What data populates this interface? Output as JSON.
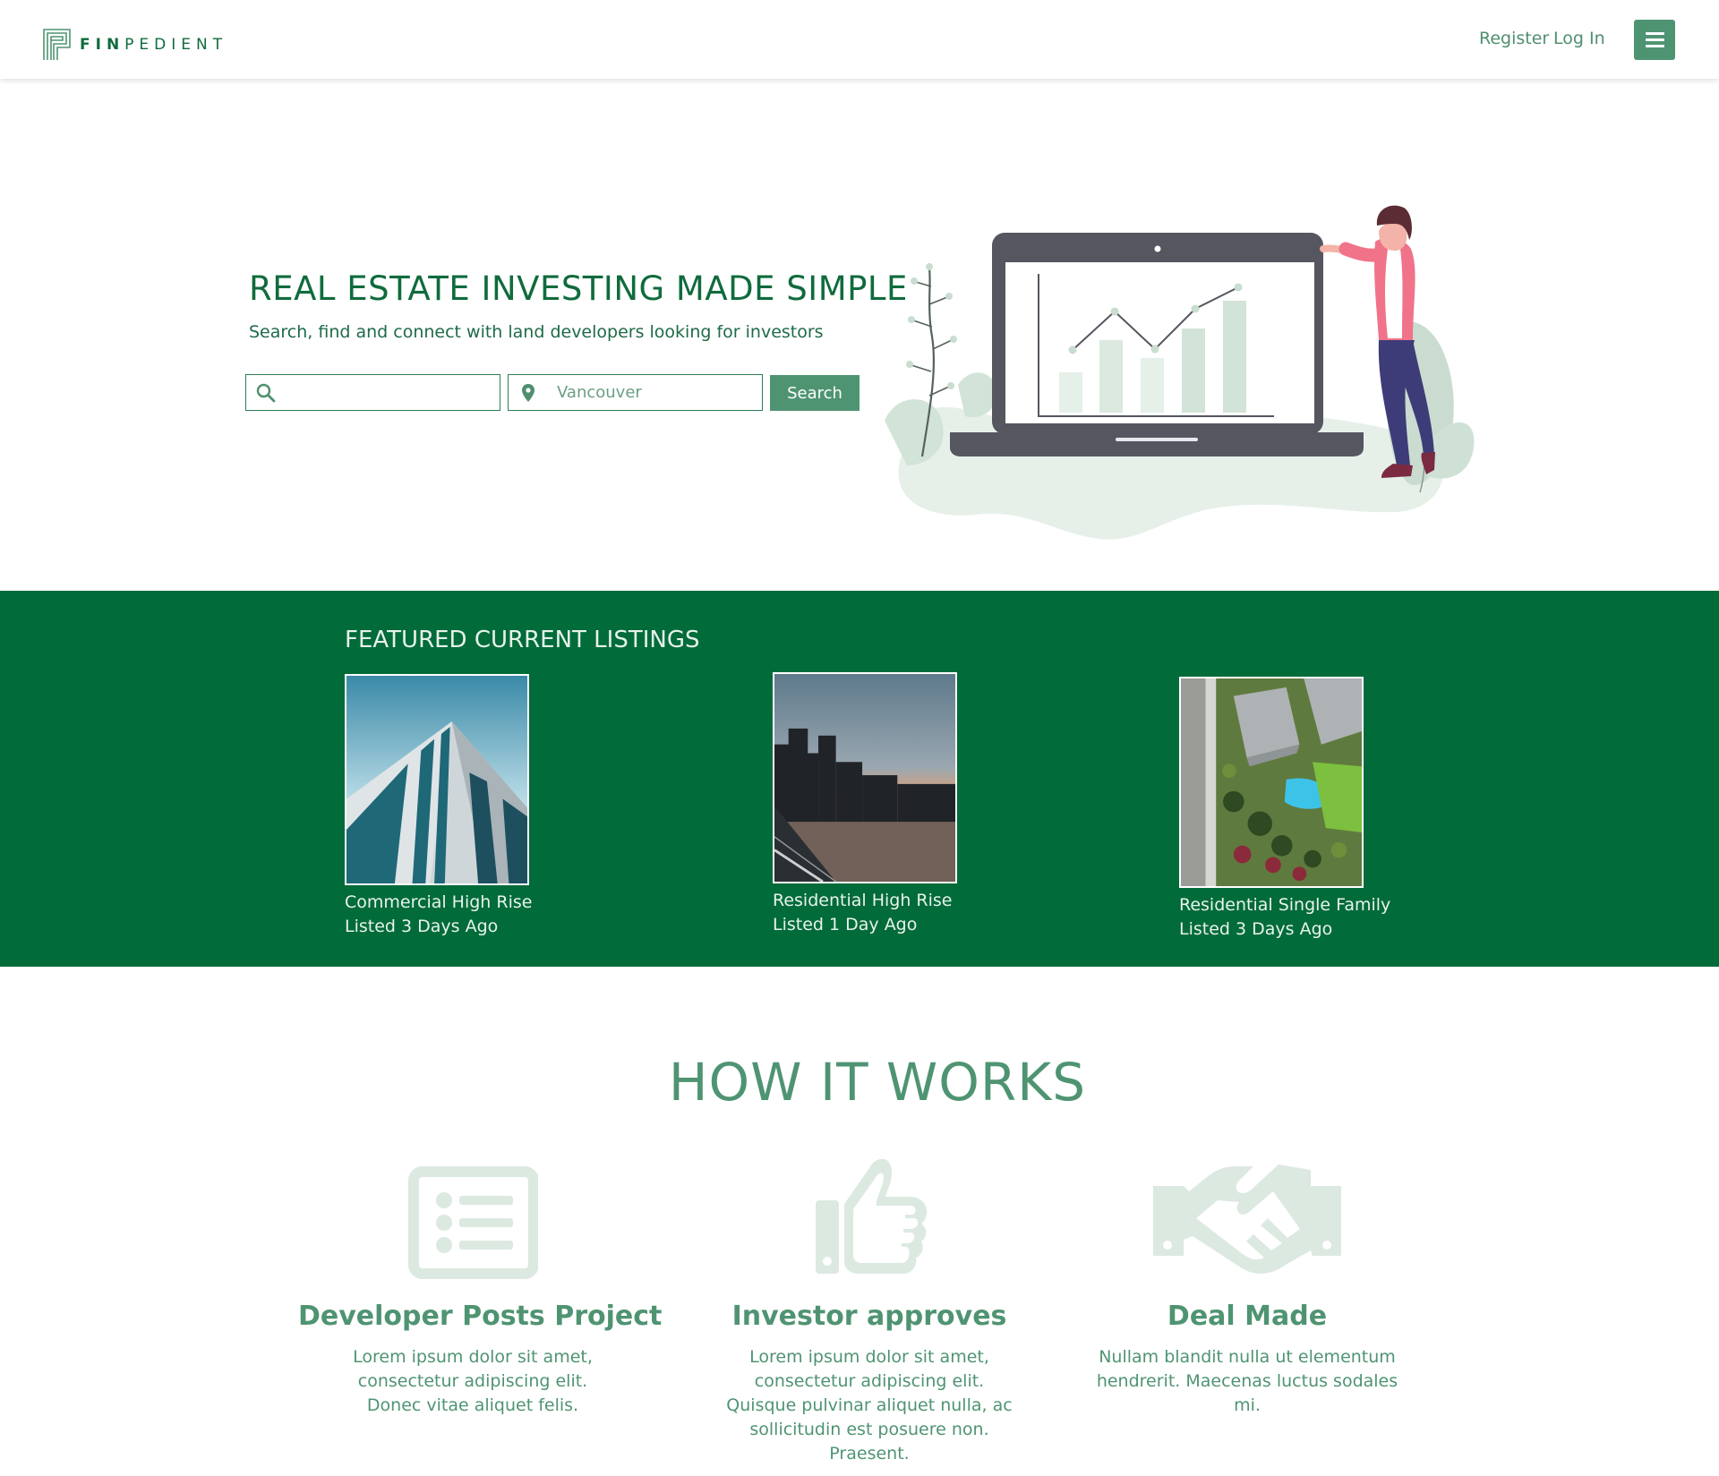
{
  "brand": {
    "name_bold": "FIN",
    "name_rest": "PEDIENT"
  },
  "nav": {
    "register": "Register",
    "login": "Log In"
  },
  "hero": {
    "title": "REAL ESTATE INVESTING MADE SIMPLE",
    "subtitle": "Search, find and connect with land developers looking for investors",
    "keyword_placeholder": "",
    "location_placeholder": "Vancouver",
    "search_button": "Search"
  },
  "featured": {
    "title": "FEATURED CURRENT LISTINGS",
    "listings": [
      {
        "name": "Commercial High Rise",
        "listed": "Listed 3 Days Ago"
      },
      {
        "name": "Residential High Rise",
        "listed": "Listed 1 Day Ago"
      },
      {
        "name": "Residential Single Family",
        "listed": "Listed 3 Days Ago"
      }
    ]
  },
  "how": {
    "title": "HOW IT WORKS",
    "steps": [
      {
        "icon": "list-icon",
        "title": "Developer Posts Project",
        "text": "Lorem ipsum dolor sit amet, consectetur adipiscing elit. Donec vitae aliquet felis."
      },
      {
        "icon": "thumbs-up-icon",
        "title": "Investor approves",
        "text": "Lorem ipsum dolor sit amet, consectetur adipiscing elit. Quisque pulvinar aliquet nulla, ac sollicitudin est posuere non. Praesent."
      },
      {
        "icon": "handshake-icon",
        "title": "Deal Made",
        "text": "Nullam blandit nulla ut elementum hendrerit. Maecenas luctus sodales mi."
      }
    ]
  },
  "colors": {
    "brand_green": "#026b3a",
    "accent_green": "#4f9472",
    "icon_tint": "#dce9e1"
  }
}
